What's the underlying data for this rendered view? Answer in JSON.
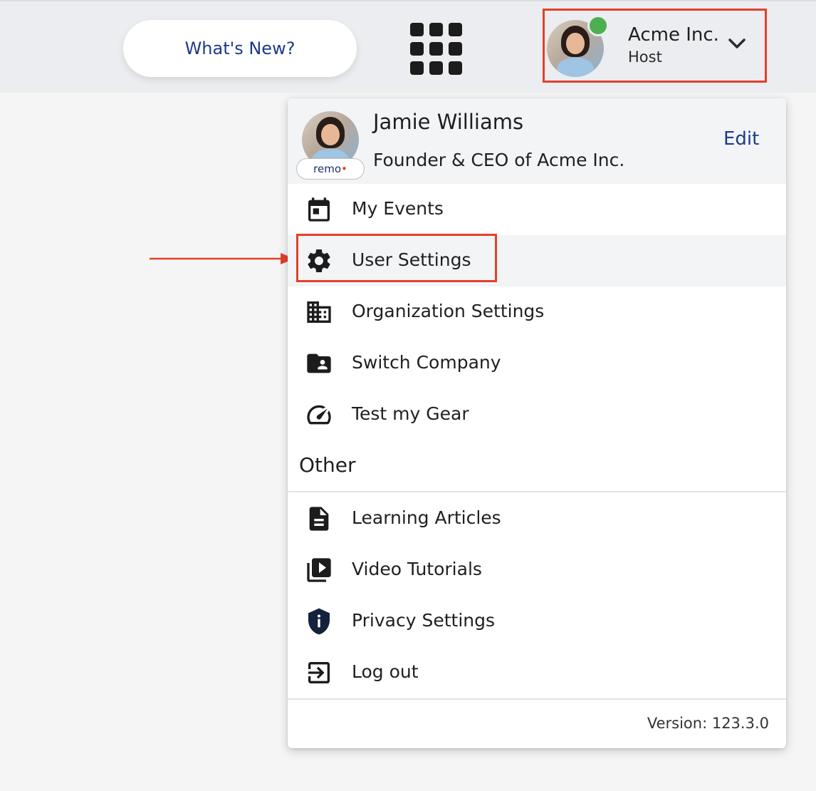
{
  "topbar": {
    "whats_new_label": "What's New?",
    "account": {
      "name": "Acme Inc.",
      "role": "Host",
      "status_color": "#4caf50"
    }
  },
  "menu": {
    "profile": {
      "name": "Jamie Williams",
      "title": "Founder & CEO of Acme Inc.",
      "badge_text": "remo",
      "edit_label": "Edit"
    },
    "items": [
      {
        "label": "My Events",
        "icon": "calendar-icon"
      },
      {
        "label": "User Settings",
        "icon": "gear-icon",
        "highlighted": true
      },
      {
        "label": "Organization Settings",
        "icon": "building-icon"
      },
      {
        "label": "Switch Company",
        "icon": "folder-user-icon"
      },
      {
        "label": "Test my Gear",
        "icon": "speedometer-icon"
      }
    ],
    "other_section_title": "Other",
    "other_items": [
      {
        "label": "Learning Articles",
        "icon": "document-icon"
      },
      {
        "label": "Video Tutorials",
        "icon": "video-library-icon"
      },
      {
        "label": "Privacy Settings",
        "icon": "shield-info-icon"
      },
      {
        "label": "Log out",
        "icon": "logout-icon"
      }
    ],
    "version_text": "Version: 123.3.0"
  },
  "colors": {
    "accent_blue": "#1d3a8a",
    "annotation_red": "#e2412a",
    "icon_dark": "#1c1c1c",
    "shield_navy": "#14213d"
  }
}
